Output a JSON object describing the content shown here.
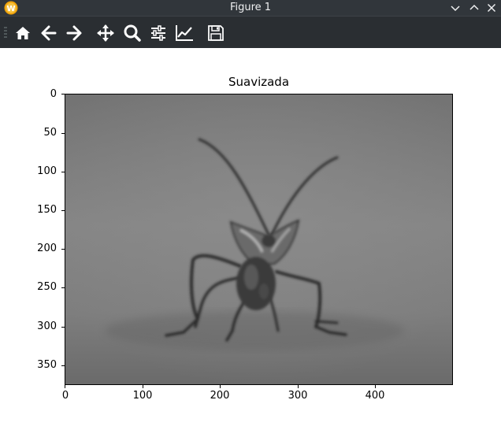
{
  "window": {
    "title": "Figure 1",
    "app_icon": "app-logo-w",
    "controls": [
      "minimize",
      "maximize",
      "close"
    ]
  },
  "toolbar": {
    "tools": [
      {
        "id": "home",
        "icon": "home-icon"
      },
      {
        "id": "back",
        "icon": "back-arrow-icon"
      },
      {
        "id": "forward",
        "icon": "forward-arrow-icon"
      },
      {
        "id": "pan",
        "icon": "move-icon"
      },
      {
        "id": "zoom",
        "icon": "zoom-icon"
      },
      {
        "id": "configure",
        "icon": "sliders-icon"
      },
      {
        "id": "edit-axis",
        "icon": "line-chart-icon"
      },
      {
        "id": "save",
        "icon": "save-icon"
      }
    ]
  },
  "plot": {
    "title": "Suavizada",
    "y_ticks": [
      "0",
      "50",
      "100",
      "150",
      "200",
      "250",
      "300",
      "350"
    ],
    "x_ticks": [
      "0",
      "100",
      "200",
      "300",
      "400"
    ],
    "image_description_icon": "blurred-grayscale-insect-photo"
  }
}
